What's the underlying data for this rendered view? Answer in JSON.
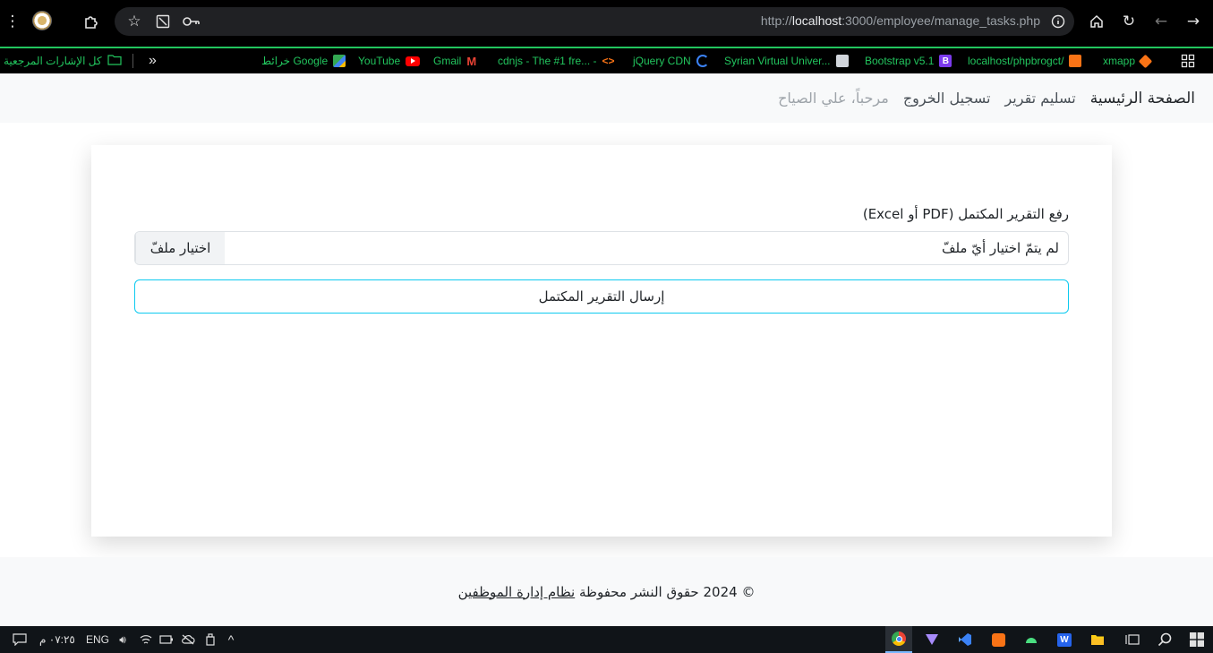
{
  "browser": {
    "url_prefix": "http://",
    "url_host": "localhost",
    "url_rest": ":3000/employee/manage_tasks.php",
    "bookmarks": [
      {
        "label": "xmapp",
        "icon": "xampp-icon",
        "color": "#f97316"
      },
      {
        "label": "localhost/phpbrogct/",
        "icon": "xampp-icon",
        "color": "#f97316"
      },
      {
        "label": "Bootstrap v5.1",
        "icon": "bootstrap-icon",
        "color": "#7c3aed"
      },
      {
        "label": "Syrian Virtual Univer...",
        "icon": "svu-icon",
        "color": "#9ca3af"
      },
      {
        "label": "jQuery CDN",
        "icon": "jquery-icon",
        "color": "#3b82f6"
      },
      {
        "label": "cdnjs - The #1 fre... -",
        "icon": "code-icon",
        "color": "#f97316"
      },
      {
        "label": "Gmail",
        "icon": "gmail-icon",
        "color": "#ea4335"
      },
      {
        "label": "YouTube",
        "icon": "youtube-icon",
        "color": "#ff0000"
      },
      {
        "label": "خرائط Google",
        "icon": "maps-icon",
        "color": "#34a853"
      }
    ],
    "all_bookmarks_label": "كل الإشارات المرجعية"
  },
  "navbar": {
    "brand": "الصفحة الرئيسية",
    "links": [
      "تسليم تقرير",
      "تسجيل الخروج"
    ],
    "welcome": "مرحباً، علي الصياح"
  },
  "form": {
    "label": "رفع التقرير المكتمل (PDF أو Excel)",
    "file_button": "اختيار ملفّ",
    "file_status": "لم يتمّ اختيار أيّ ملفّ",
    "submit": "إرسال التقرير المكتمل"
  },
  "footer": {
    "text": "© 2024 حقوق النشر محفوظة",
    "link": "نظام إدارة الموظفين"
  },
  "taskbar": {
    "time": "٠٧:٢٥ م",
    "language": "ENG"
  }
}
